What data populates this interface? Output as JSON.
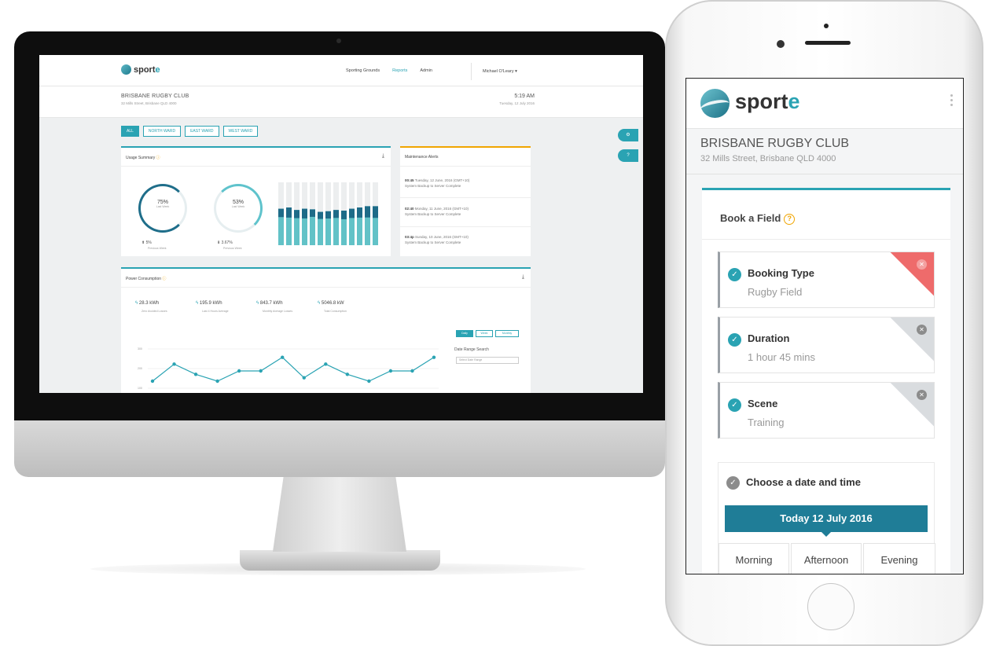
{
  "desktop": {
    "brand": {
      "name_prefix": "sport",
      "name_suffix": "e"
    },
    "nav": {
      "items": [
        "Sporting Grounds",
        "Reports",
        "Admin"
      ],
      "user": "Michael O'Leary ▾"
    },
    "club": {
      "name": "BRISBANE RUGBY CLUB",
      "address": "32 Mills Street, Brisbane QLD 4000",
      "time": "5:19 AM",
      "date": "Tuesday, 12 July 2016"
    },
    "tabs": [
      "ALL",
      "NORTH WARD",
      "EAST WARD",
      "WEST WARD"
    ],
    "side_buttons": [
      "⚙",
      "?"
    ],
    "usage": {
      "title": "Usage Summary",
      "rings": [
        {
          "value": "75%",
          "label": "Last Week",
          "stat": "5%",
          "stat_label": "Previous Week"
        },
        {
          "value": "53%",
          "label": "Last Week",
          "stat": "3.67%",
          "stat_label": "Previous Week"
        }
      ]
    },
    "alerts": {
      "title": "Maintenance Alerts",
      "items": [
        {
          "code": "00:45",
          "when": "Tuesday, 12 June, 2016 (GMT+10)",
          "text": "System Backup to Server Complete"
        },
        {
          "code": "02:40",
          "when": "Monday, 11 June, 2016 (GMT+10)",
          "text": "System Backup to Server Complete"
        },
        {
          "code": "03:4p",
          "when": "Sunday, 10 June, 2016 (GMT+10)",
          "text": "System Backup to Server Complete"
        }
      ]
    },
    "power": {
      "title": "Power Consumption",
      "metrics": [
        {
          "value": "28.3 kWh",
          "label": "Zero Avoided Losses"
        },
        {
          "value": "195.9 kWh",
          "label": "Last 4 Hours Average"
        },
        {
          "value": "843.7 kWh",
          "label": "Monthly Average Losses"
        },
        {
          "value": "5046.8 kW",
          "label": "Total Consumption"
        }
      ],
      "periods": [
        "Daily",
        "Week",
        "Monthly"
      ],
      "range_label": "Date Range Search",
      "range_placeholder": "Select Date Range",
      "y_ticks": [
        "300",
        "200",
        "100"
      ]
    },
    "usage_bars": {
      "dark": [
        38,
        46,
        37,
        44,
        34,
        32,
        33,
        36,
        39,
        42,
        46,
        51,
        53
      ],
      "light": [
        58,
        60,
        56,
        58,
        57,
        53,
        54,
        56,
        55,
        58,
        60,
        62,
        62
      ]
    },
    "power_line": [
      103,
      108,
      105,
      103,
      106,
      106,
      110,
      104,
      108,
      105,
      103,
      106,
      106,
      110
    ]
  },
  "mobile": {
    "brand": {
      "name_prefix": "sport",
      "name_suffix": "e"
    },
    "club": {
      "name": "BRISBANE RUGBY CLUB",
      "address": "32 Mills Street, Brisbane QLD 4000"
    },
    "card_title": "Book a Field",
    "help": "?",
    "selections": [
      {
        "label": "Booking Type",
        "value": "Rugby Field",
        "status": "active"
      },
      {
        "label": "Duration",
        "value": "1 hour 45 mins",
        "status": "set"
      },
      {
        "label": "Scene",
        "value": "Training",
        "status": "set"
      }
    ],
    "date_time": {
      "label": "Choose a date and time",
      "day": "Today 12 July 2016",
      "slots": [
        "Morning",
        "Afternoon",
        "Evening"
      ]
    }
  }
}
